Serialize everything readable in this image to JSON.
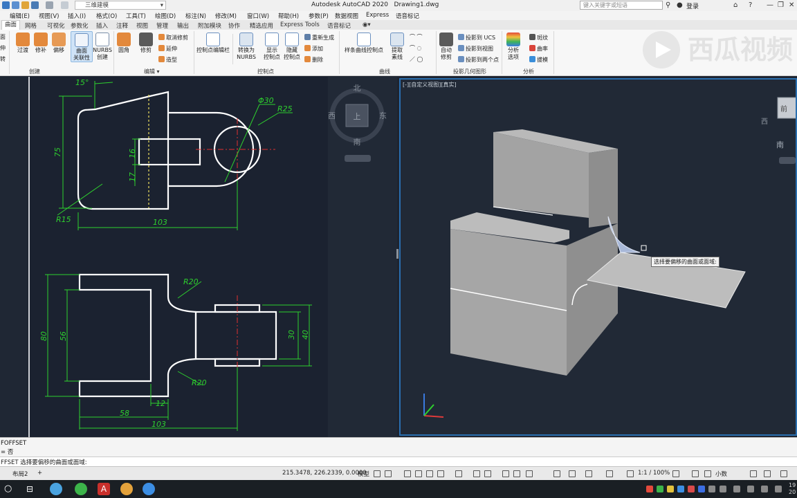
{
  "titlebar": {
    "workspace": "三维建模",
    "app_title": "Autodesk AutoCAD 2020",
    "file_name": "Drawing1.dwg",
    "search_placeholder": "键入关键字或短语",
    "login": "登录"
  },
  "menubar": [
    "编辑(E)",
    "视图(V)",
    "插入(I)",
    "格式(O)",
    "工具(T)",
    "绘图(D)",
    "标注(N)",
    "修改(M)",
    "窗口(W)",
    "帮助(H)",
    "参数(P)",
    "数据视图",
    "Express",
    "语音标记"
  ],
  "tabs": {
    "active": "曲面",
    "items": [
      "网格",
      "可视化",
      "参数化",
      "插入",
      "注释",
      "视图",
      "管理",
      "输出",
      "附加模块",
      "协作",
      "精选应用",
      "Express Tools",
      "语音标记"
    ]
  },
  "ribbon": {
    "create_left": [
      "面",
      "伸",
      "转"
    ],
    "create": {
      "label": "创建",
      "buttons": [
        "过渡",
        "修补",
        "偏移",
        "曲面\n关联性",
        "NURBS\n创建"
      ]
    },
    "edit": {
      "label": "编辑",
      "buttons": [
        "圆角",
        "修剪"
      ],
      "small": [
        "取消修剪",
        "延伸",
        "造型"
      ]
    },
    "controls": {
      "label": "控制点",
      "buttons": [
        "控制点编辑栏",
        "转换为\nNURBS",
        "显示\n控制点",
        "隐藏\n控制点"
      ],
      "small": [
        "重新生成",
        "添加",
        "删除"
      ]
    },
    "curves": {
      "label": "曲线",
      "buttons": [
        "样条曲线控制点",
        "提取\n素线"
      ]
    },
    "projection": {
      "label": "投影几何图形",
      "buttons": [
        "自动\n修剪"
      ],
      "small": [
        "投影到 UCS",
        "投影到视图",
        "投影到两个点"
      ]
    },
    "analysis": {
      "label": "分析",
      "buttons": [
        "分析\n选项"
      ],
      "small": [
        "斑纹",
        "曲率",
        "拔模"
      ]
    }
  },
  "logo_text": "西瓜视频",
  "drawing": {
    "angle": "15°",
    "dims_top": [
      "75",
      "16",
      "17",
      "R15",
      "103",
      "Φ30",
      "R25"
    ],
    "dims_bottom": [
      "R20",
      "80",
      "56",
      "R20",
      "30",
      "40",
      "12",
      "58",
      "103"
    ]
  },
  "viewcube": {
    "north": "北",
    "south": "南",
    "west": "西",
    "east": "东",
    "top": "上"
  },
  "viewcube_right": {
    "west": "西",
    "south": "南",
    "face": "前"
  },
  "viewport_label": "[-][自定义视图][真实]",
  "tooltip": "选择要偏移的曲面或面域:",
  "command": {
    "line1": "FOFFSET",
    "line2": "= 否",
    "prompt": "FFSET 选择要偏移的曲面或面域:"
  },
  "status": {
    "layout_tab": "布局2",
    "coords": "215.3478, 226.2339, 0.0000",
    "model": "模型",
    "scale": "1:1 / 100%",
    "units": "小数"
  },
  "clock": "19\n20"
}
